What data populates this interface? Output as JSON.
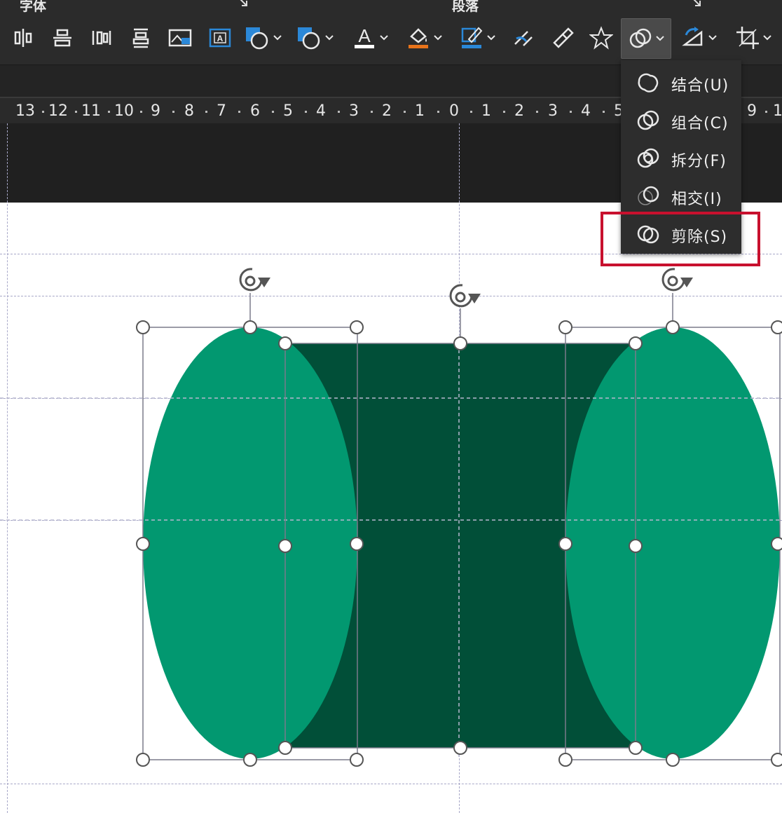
{
  "ribbon": {
    "group_labels": [
      "字体",
      "段落"
    ],
    "dropdown_items": [
      {
        "label": "结合(U)",
        "icon": "shapes-union-icon"
      },
      {
        "label": "组合(C)",
        "icon": "shapes-combine-icon"
      },
      {
        "label": "拆分(F)",
        "icon": "shapes-fragment-icon"
      },
      {
        "label": "相交(I)",
        "icon": "shapes-intersect-icon"
      },
      {
        "label": "剪除(S)",
        "icon": "shapes-subtract-icon"
      }
    ],
    "highlighted_item": "剪除(S)"
  },
  "ruler": {
    "ticks": [
      "13",
      "12",
      "11",
      "10",
      "9",
      "8",
      "7",
      "6",
      "5",
      "4",
      "3",
      "2",
      "1",
      "0",
      "1",
      "2",
      "3",
      "4",
      "5",
      "9",
      "1"
    ]
  },
  "colors": {
    "ellipse_fill": "#029870",
    "rect_fill": "#014f38",
    "toolbar_bg": "#2b2b2b",
    "highlight_border": "#c8102e",
    "accent_blue": "#2b88d8",
    "accent_orange": "#e8731a"
  }
}
